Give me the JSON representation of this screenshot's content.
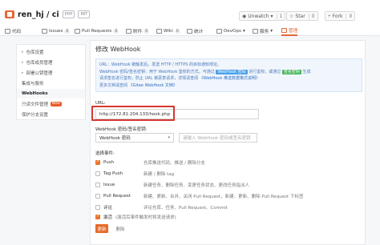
{
  "header": {
    "repo_name": "ren_hj / ci",
    "tags": [
      "PHP",
      "MIT"
    ],
    "watch_label": "Unwatch",
    "watch_count": "1",
    "star_label": "Star",
    "star_count": "0",
    "fork_label": "Fork",
    "fork_count": "0"
  },
  "nav": {
    "items": [
      {
        "label": "代码",
        "icon": "code-icon"
      },
      {
        "label": "Issues",
        "badge": "0",
        "icon": "issue-icon"
      },
      {
        "label": "Pull Requests",
        "badge": "0",
        "icon": "pr-icon"
      },
      {
        "label": "附件",
        "badge": "0",
        "icon": "attachment-icon"
      },
      {
        "label": "Wiki",
        "badge": "0",
        "icon": "wiki-icon"
      },
      {
        "label": "统计",
        "icon": "stats-icon"
      },
      {
        "label": "DevOps",
        "icon": "devops-icon"
      },
      {
        "label": "服务",
        "icon": "service-icon"
      },
      {
        "label": "管理",
        "icon": "settings-icon",
        "active": true
      }
    ]
  },
  "sidebar": {
    "items": [
      {
        "label": "仓库设置",
        "type": "section"
      },
      {
        "label": "仓库成员管理",
        "type": "section"
      },
      {
        "label": "部署公钥管理",
        "type": "section"
      },
      {
        "label": "集成与服务",
        "type": "plain"
      },
      {
        "label": "WebHooks",
        "type": "active"
      },
      {
        "label": "只读文件管理",
        "type": "plain",
        "badge": "New"
      },
      {
        "label": "保护分支设置",
        "type": "plain"
      }
    ]
  },
  "main": {
    "title": "修改 WebHook",
    "info": {
      "line1": "URL：WebHook 被触发后，发送 HTTP / HTTPS 的目标通知地址。",
      "line2a": "WebHook 密码/签名密钥：用于 WebHook 鉴权的方式，可通过",
      "line2b": "WebHook 密码",
      "line2c": "进行鉴权，或通过",
      "line2d": "签名密钥",
      "line2e": "生成",
      "line3a": "请求签名进行鉴权，防止 URL 被恶意请求，详情请查阅",
      "line3b": "《WebHook 推送数据格式说明》",
      "line4a": "更多文档请查阅",
      "line4b": "《Gitee WebHook 文档》"
    },
    "url_label": "URL:",
    "url_value": "http://172.81.204.133/hook.php",
    "method_label": "WebHook 密码/签名密钥:",
    "method_value": "WebHook 密码",
    "password_placeholder": "请输入 WebHook 密码或签名密钥",
    "events_label": "选择事件:",
    "events": [
      {
        "name": "Push",
        "desc": "仓库推送代码、推送 / 删除分支",
        "checked": true
      },
      {
        "name": "Tag Push",
        "desc": "新建 / 删除 tag",
        "checked": false
      },
      {
        "name": "Issue",
        "desc": "新建任务、删除任务、变更任务状态、更改任务指派人",
        "checked": false
      },
      {
        "name": "Pull Request",
        "desc": "新建、更新、合并、关闭 Pull Request，新建、更新、删除 Pull Request 下标签",
        "checked": false
      },
      {
        "name": "评论",
        "desc": "评论仓库、任务、Pull Request、Commit",
        "checked": false
      }
    ],
    "activate_label": "激活",
    "activate_desc": "(激活后事件触发时将发送请求)",
    "submit_label": "更新",
    "cancel_label": "删除"
  }
}
